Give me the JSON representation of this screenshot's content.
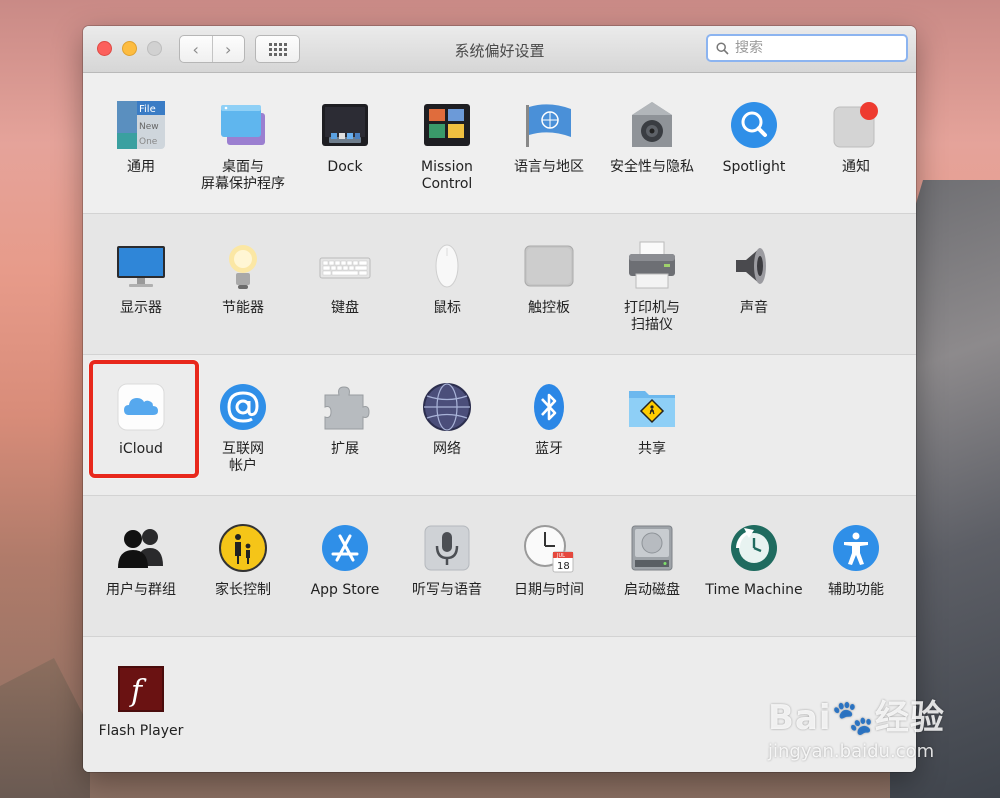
{
  "window": {
    "title": "系统偏好设置",
    "search_placeholder": "搜索",
    "back_glyph": "‹",
    "forward_glyph": "›"
  },
  "sections": [
    {
      "items": [
        {
          "label": "通用",
          "icon": "general-icon"
        },
        {
          "label": "桌面与\n屏幕保护程序",
          "icon": "desktop-screensaver-icon"
        },
        {
          "label": "Dock",
          "icon": "dock-icon"
        },
        {
          "label": "Mission\nControl",
          "icon": "mission-control-icon"
        },
        {
          "label": "语言与地区",
          "icon": "language-region-icon"
        },
        {
          "label": "安全性与隐私",
          "icon": "security-privacy-icon"
        },
        {
          "label": "Spotlight",
          "icon": "spotlight-icon"
        },
        {
          "label": "通知",
          "icon": "notifications-icon"
        }
      ]
    },
    {
      "items": [
        {
          "label": "显示器",
          "icon": "displays-icon"
        },
        {
          "label": "节能器",
          "icon": "energy-saver-icon"
        },
        {
          "label": "键盘",
          "icon": "keyboard-icon"
        },
        {
          "label": "鼠标",
          "icon": "mouse-icon"
        },
        {
          "label": "触控板",
          "icon": "trackpad-icon"
        },
        {
          "label": "打印机与\n扫描仪",
          "icon": "printers-scanners-icon"
        },
        {
          "label": "声音",
          "icon": "sound-icon"
        }
      ]
    },
    {
      "items": [
        {
          "label": "iCloud",
          "icon": "icloud-icon"
        },
        {
          "label": "互联网\n帐户",
          "icon": "internet-accounts-icon"
        },
        {
          "label": "扩展",
          "icon": "extensions-icon"
        },
        {
          "label": "网络",
          "icon": "network-icon"
        },
        {
          "label": "蓝牙",
          "icon": "bluetooth-icon"
        },
        {
          "label": "共享",
          "icon": "sharing-icon"
        }
      ]
    },
    {
      "items": [
        {
          "label": "用户与群组",
          "icon": "users-groups-icon"
        },
        {
          "label": "家长控制",
          "icon": "parental-controls-icon"
        },
        {
          "label": "App Store",
          "icon": "app-store-icon"
        },
        {
          "label": "听写与语音",
          "icon": "dictation-speech-icon"
        },
        {
          "label": "日期与时间",
          "icon": "date-time-icon"
        },
        {
          "label": "启动磁盘",
          "icon": "startup-disk-icon"
        },
        {
          "label": "Time Machine",
          "icon": "time-machine-icon"
        },
        {
          "label": "辅助功能",
          "icon": "accessibility-icon"
        }
      ]
    },
    {
      "items": [
        {
          "label": "Flash Player",
          "icon": "flash-player-icon"
        }
      ]
    }
  ],
  "icon_text": {
    "general_file": "File",
    "general_new": "New",
    "general_open": "One",
    "calendar_month": "JUL",
    "calendar_day": "18",
    "flash_f": "f"
  },
  "watermark": {
    "main": "Bai🐾经验",
    "sub": "jingyan.baidu.com"
  },
  "colors": {
    "highlight": "#e8281c",
    "search_focus": "#8cb4f0"
  }
}
